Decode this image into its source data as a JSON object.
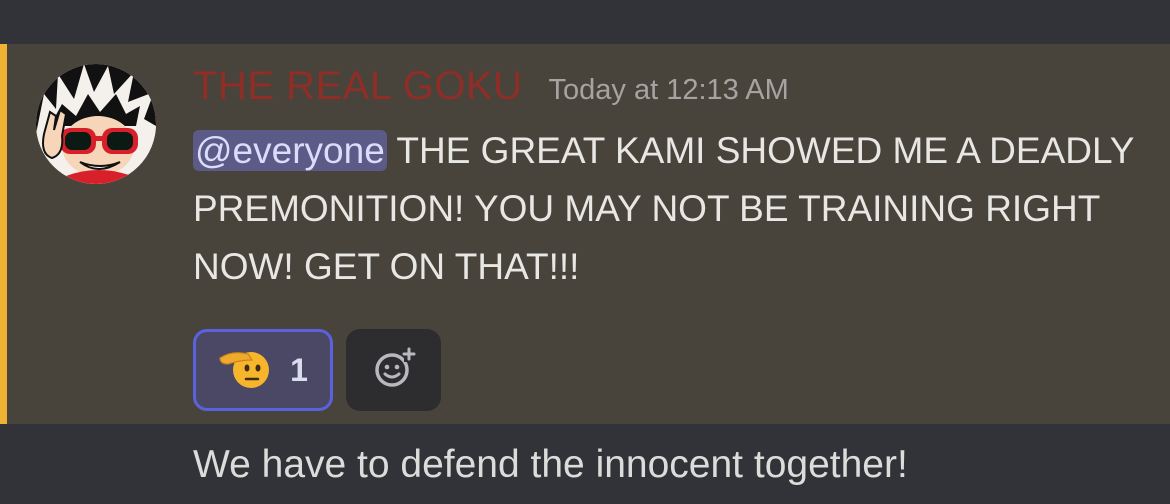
{
  "message": {
    "author": "THE REAL GOKU",
    "timestamp": "Today at 12:13 AM",
    "mention": "@everyone",
    "text": " THE GREAT KAMI SHOWED ME A DEADLY PREMONITION! YOU MAY NOT BE TRAINING RIGHT NOW! GET ON THAT!!!",
    "reactions": [
      {
        "emoji": "saluting-face",
        "count": "1",
        "selected": true
      }
    ],
    "add_reaction_icon": "add-reaction-icon"
  },
  "next_message": {
    "text": "We have to defend the innocent together!"
  },
  "colors": {
    "background": "#313338",
    "mention_highlight": "#48443c",
    "mention_bar": "#f0b232",
    "username": "#8f2d26",
    "mention_pill": "#5c5a86",
    "reaction_border": "#5a62dd"
  }
}
